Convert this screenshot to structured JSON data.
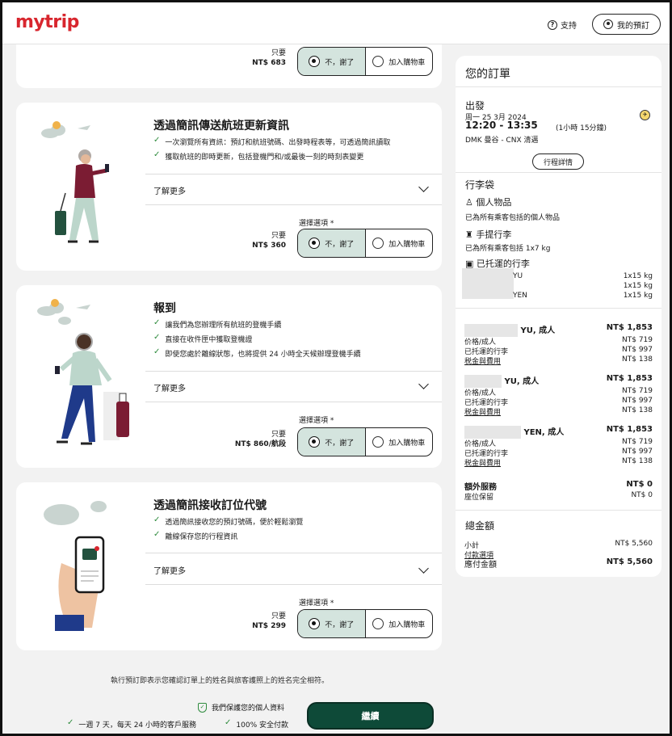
{
  "header": {
    "logo": "mytrip",
    "support": "支持",
    "my_booking": "我的預訂"
  },
  "card0": {
    "price_prefix": "只要",
    "price": "NT$ 683",
    "no_thanks": "不，謝了",
    "add_cart": "加入購物車"
  },
  "card1": {
    "title": "透過簡訊傳送航班更新資訊",
    "features": [
      "一次瀏覽所有資訊：預訂和航班號碼、出發時程表等，可透過簡訊讀取",
      "獲取航班的即時更新，包括登機門和/或最後一刻的時刻表變更"
    ],
    "more": "了解更多",
    "select_label": "選擇選項 *",
    "price_prefix": "只要",
    "price": "NT$ 360",
    "no_thanks": "不，謝了",
    "add_cart": "加入購物車"
  },
  "card2": {
    "title": "報到",
    "features": [
      "讓我們為您辦理所有航班的登機手續",
      "直接在收件匣中獲取登機證",
      "即使您處於離線狀態，也將提供 24 小時全天候辦理登機手續"
    ],
    "more": "了解更多",
    "select_label": "選擇選項 *",
    "price_prefix": "只要",
    "price": "NT$ 860/航段",
    "no_thanks": "不，謝了",
    "add_cart": "加入購物車"
  },
  "card3": {
    "title": "透過簡訊接收訂位代號",
    "features": [
      "透過簡訊接收您的預訂號碼，便於輕鬆瀏覽",
      "離線保存您的行程資訊"
    ],
    "more": "了解更多",
    "select_label": "選擇選項 *",
    "price_prefix": "只要",
    "price": "NT$ 299",
    "no_thanks": "不，謝了",
    "add_cart": "加入購物車"
  },
  "order": {
    "title": "您的訂單",
    "flight": {
      "label": "出發",
      "date": "周一 25 3月 2024",
      "time": "12:20 - 13:35",
      "duration": "(1小時 15分鐘)",
      "route": "DMK 曼谷 - CNX 清邁",
      "details_button": "行程詳情"
    },
    "baggage": {
      "title": "行李袋",
      "personal": "個人物品",
      "personal_note": "已為所有乘客包括的個人物品",
      "carry_on": "手提行李",
      "carry_on_note": "已為所有乘客包括 1x7 kg",
      "checked": "已托運的行李",
      "checked_rows": [
        {
          "name": "YU",
          "value": "1x15 kg"
        },
        {
          "name": "",
          "value": "1x15 kg"
        },
        {
          "name": "YEN",
          "value": "1x15 kg"
        }
      ]
    },
    "passengers": [
      {
        "name": "YU, 成人",
        "total": "NT$ 1,853",
        "fare_label": "价格/成人",
        "fare": "NT$ 719",
        "bag_label": "已托運的行李",
        "bag": "NT$ 997",
        "tax_label": "税金與費用",
        "tax": "NT$ 138"
      },
      {
        "name": "YU, 成人",
        "total": "NT$ 1,853",
        "fare_label": "价格/成人",
        "fare": "NT$ 719",
        "bag_label": "已托運的行李",
        "bag": "NT$ 997",
        "tax_label": "税金與費用",
        "tax": "NT$ 138"
      },
      {
        "name": "YEN, 成人",
        "total": "NT$ 1,853",
        "fare_label": "价格/成人",
        "fare": "NT$ 719",
        "bag_label": "已托運的行李",
        "bag": "NT$ 997",
        "tax_label": "税金與費用",
        "tax": "NT$ 138"
      }
    ],
    "extras": {
      "label": "額外服務",
      "total": "NT$ 0",
      "seat_label": "座位保留",
      "seat": "NT$ 0"
    },
    "summary": {
      "title": "總金額",
      "subtotal_label": "小計",
      "subtotal": "NT$ 5,560",
      "payment_label": "付款選項",
      "due_label": "應付金額",
      "due": "NT$ 5,560"
    }
  },
  "footer": {
    "note": "執行預訂即表示您確認訂單上的姓名與旅客護照上的姓名完全相符。",
    "privacy": "我們保護您的個人資料",
    "support247": "一週 7 天，每天 24 小時的客戶服務",
    "secure": "100% 安全付款",
    "continue": "繼續"
  },
  "colors": {
    "brand": "#d8262e",
    "cta": "#0e4a38",
    "check": "#2e8b3d",
    "selected": "#d4e4de"
  }
}
